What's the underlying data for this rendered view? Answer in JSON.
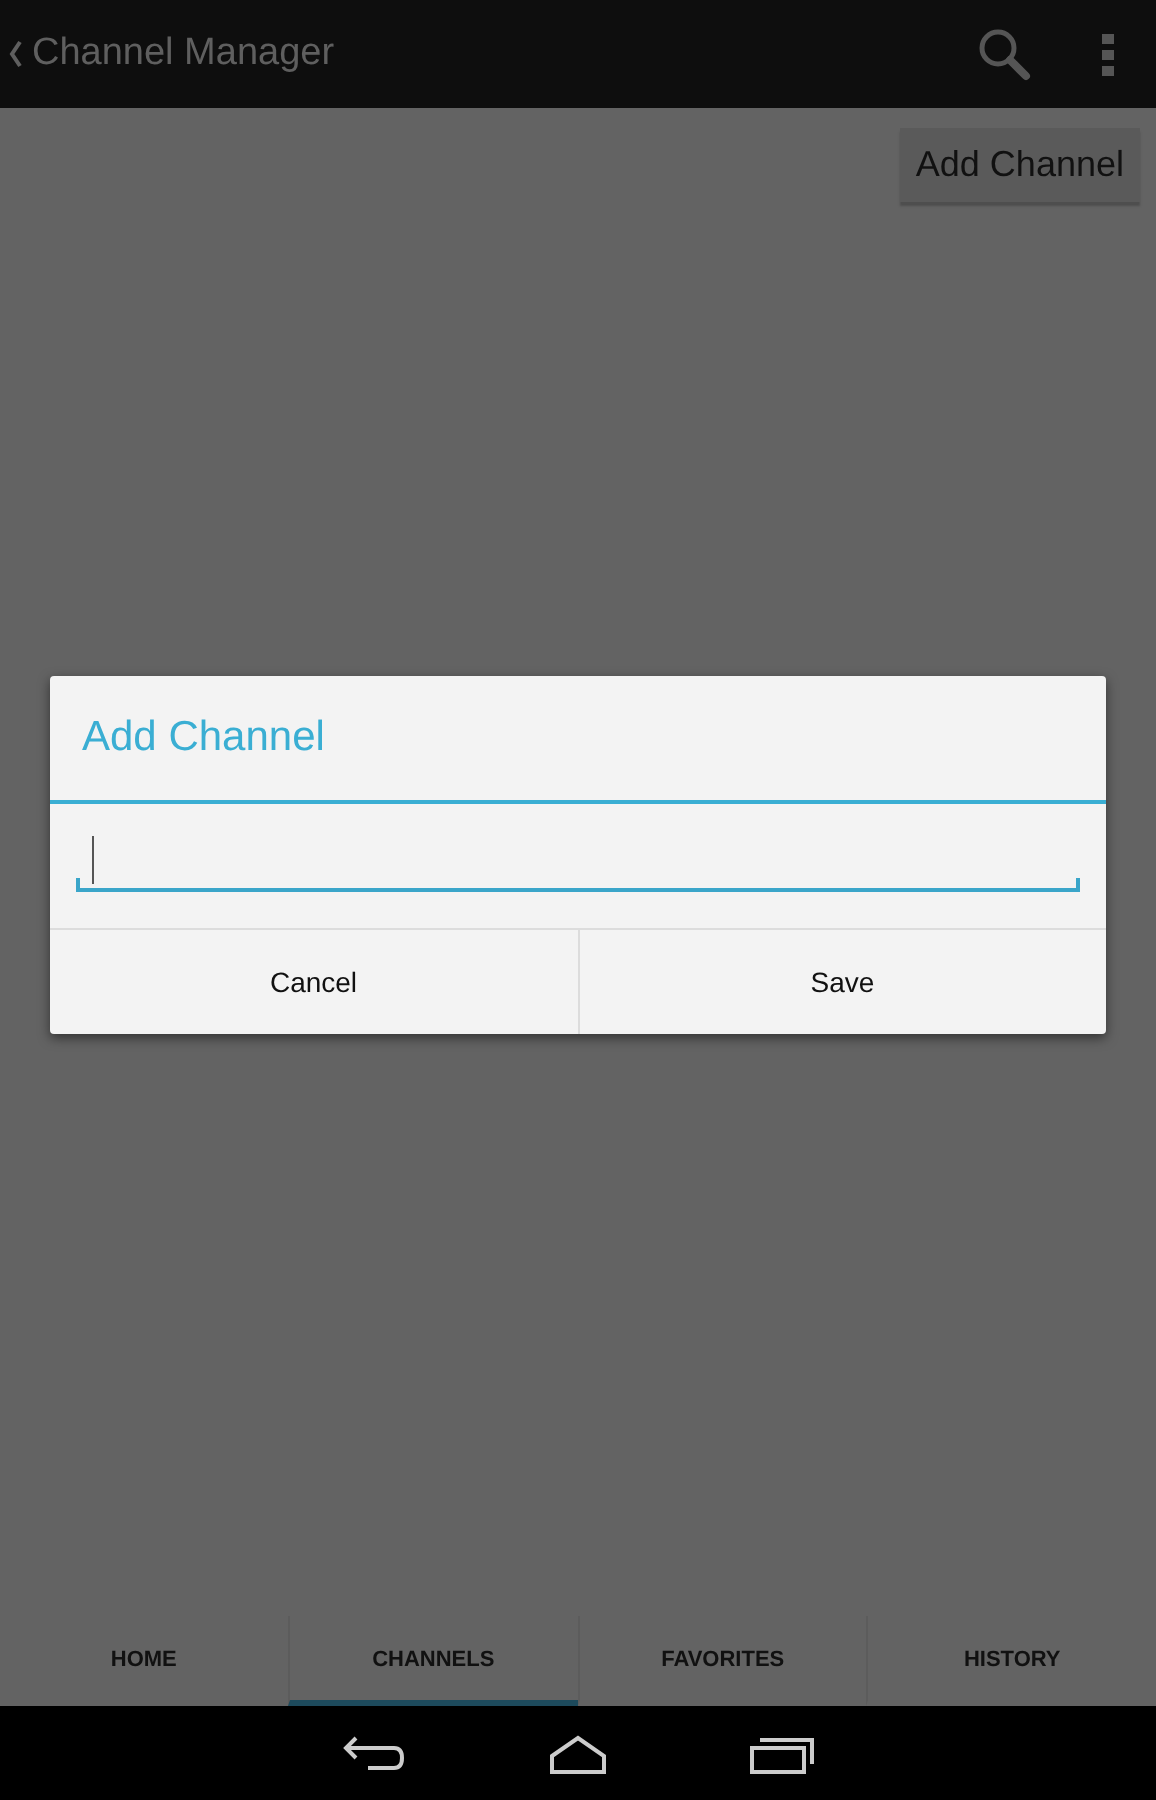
{
  "action_bar": {
    "title": "Channel Manager"
  },
  "content": {
    "add_button": "Add Channel"
  },
  "dialog": {
    "title": "Add Channel",
    "buttons": [
      "Cancel",
      "Save"
    ]
  },
  "tabs": [
    {
      "label": "HOME",
      "selected": false
    },
    {
      "label": "CHANNELS",
      "selected": true
    },
    {
      "label": "FAVORITES",
      "selected": false
    },
    {
      "label": "HISTORY",
      "selected": false
    }
  ]
}
